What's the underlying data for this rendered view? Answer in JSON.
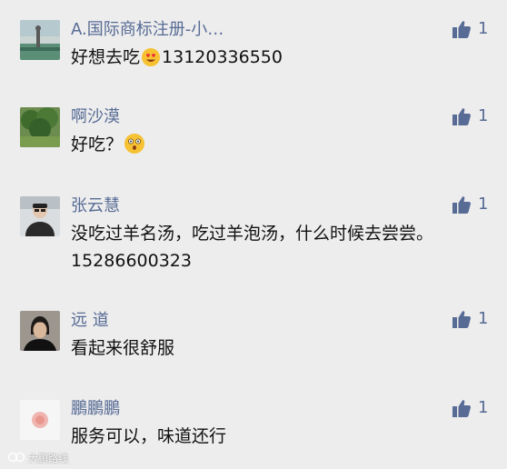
{
  "comments": [
    {
      "name": "A.国际商标注册-小…",
      "text_before": "好想去吃",
      "emoji": "heart-eyes-emoji",
      "text_after": "13120336550",
      "likes": "1",
      "avatar": "landscape-person-avatar"
    },
    {
      "name": "啊沙漠",
      "text_before": "好吃？",
      "emoji": "surprised-emoji",
      "likes": "1",
      "avatar": "tree-avatar"
    },
    {
      "name": "张云慧",
      "text_line1": "没吃过羊名汤，吃过羊泡汤，什么时候去尝尝。",
      "text_line2": "15286600323",
      "likes": "1",
      "avatar": "man-photo-avatar"
    },
    {
      "name": "远 道",
      "text_before": "看起来很舒服",
      "likes": "1",
      "avatar": "portrait-avatar"
    },
    {
      "name": "鵬鵬鵬",
      "text_before": "服务可以，味道还行",
      "likes": "1",
      "avatar": "pink-circle-avatar"
    }
  ],
  "watermark": "大鹏路线",
  "colors": {
    "name": "#576b95",
    "text": "#111111",
    "background": "#ededed"
  }
}
